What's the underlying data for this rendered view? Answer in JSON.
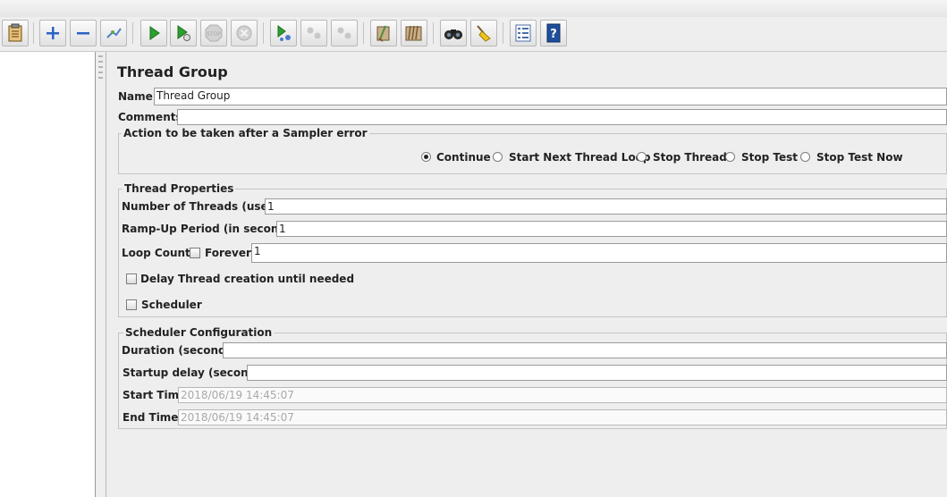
{
  "toolbar": {
    "icons": [
      "clipboard-icon",
      "plus-icon",
      "minus-icon",
      "toggle-icon",
      "start-icon",
      "start-no-pause-icon",
      "stop-icon",
      "shutdown-icon",
      "remote-start-icon",
      "remote-stop-icon",
      "remote-shutdown-icon",
      "clear-icon",
      "clear-all-icon",
      "search-icon",
      "reset-search-icon",
      "function-helper-icon",
      "help-icon"
    ]
  },
  "panel": {
    "title": "Thread Group",
    "name_label": "Name:",
    "name_value": "Thread Group",
    "comments_label": "Comments:",
    "comments_value": ""
  },
  "sampler_error": {
    "legend": "Action to be taken after a Sampler error",
    "options": [
      "Continue",
      "Start Next Thread Loop",
      "Stop Thread",
      "Stop Test",
      "Stop Test Now"
    ],
    "selected": "Continue"
  },
  "thread_props": {
    "legend": "Thread Properties",
    "threads_label": "Number of Threads (users):",
    "threads_value": "1",
    "rampup_label": "Ramp-Up Period (in seconds):",
    "rampup_value": "1",
    "loop_label": "Loop Count:",
    "forever_label": "Forever",
    "forever_checked": false,
    "loop_value": "1",
    "delay_label": "Delay Thread creation until needed",
    "delay_checked": false,
    "scheduler_label": "Scheduler",
    "scheduler_checked": false
  },
  "scheduler": {
    "legend": "Scheduler Configuration",
    "duration_label": "Duration (seconds)",
    "duration_value": "",
    "startup_label": "Startup delay (seconds)",
    "startup_value": "",
    "start_label": "Start Time",
    "start_value": "2018/06/19 14:45:07",
    "end_label": "End Time",
    "end_value": "2018/06/19 14:45:07"
  }
}
